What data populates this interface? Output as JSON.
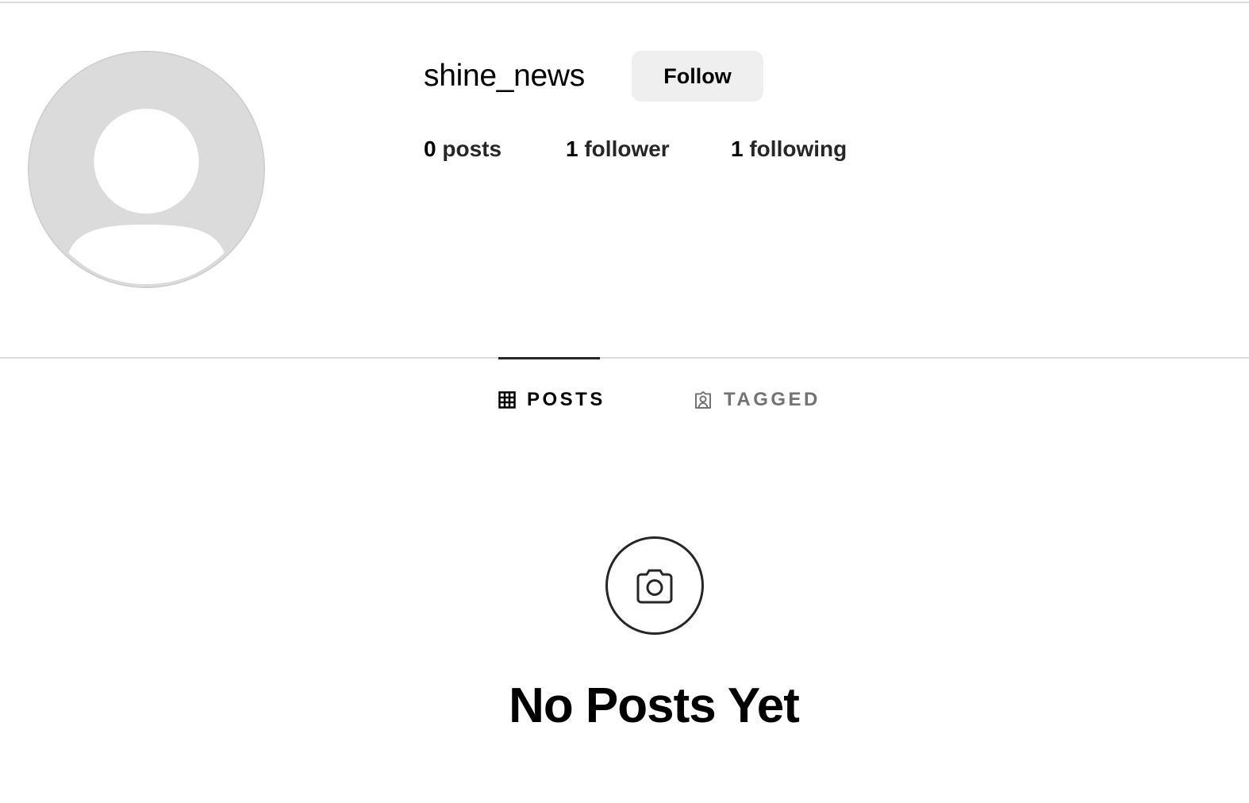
{
  "profile": {
    "username": "shine_news",
    "follow_label": "Follow",
    "avatar_icon": "default-avatar-icon"
  },
  "stats": {
    "posts_count": "0",
    "posts_label": "posts",
    "followers_count": "1",
    "followers_label": "follower",
    "following_count": "1",
    "following_label": "following"
  },
  "tabs": [
    {
      "label": "POSTS",
      "icon": "grid-icon",
      "active": true
    },
    {
      "label": "TAGGED",
      "icon": "tagged-user-icon",
      "active": false
    }
  ],
  "empty_state": {
    "icon": "camera-icon",
    "title": "No Posts Yet"
  },
  "colors": {
    "background": "#ffffff",
    "button_bg": "#efefef",
    "divider": "#dbdbdb",
    "active_tab": "#000000",
    "inactive_tab": "#737373",
    "avatar_bg": "#dbdbdb"
  }
}
